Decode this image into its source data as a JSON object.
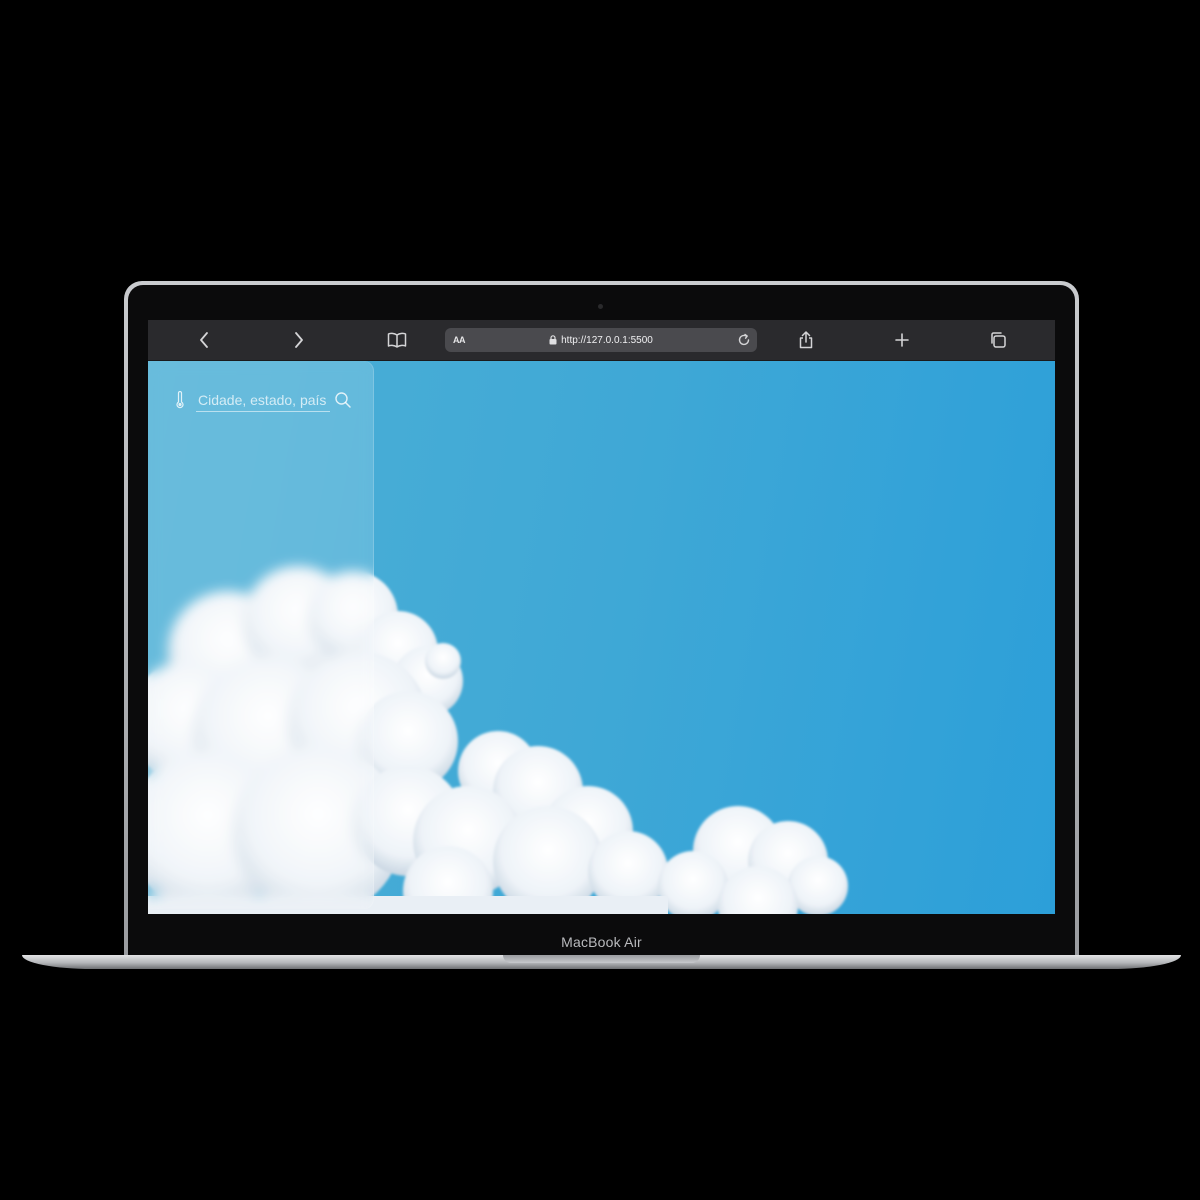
{
  "device": {
    "label": "MacBook Air"
  },
  "browser": {
    "reader_label": "AA",
    "url": "http://127.0.0.1:5500",
    "icons": [
      "back-icon",
      "forward-icon",
      "bookmarks-icon",
      "lock-icon",
      "reload-icon",
      "share-icon",
      "new-tab-icon",
      "tabs-icon"
    ]
  },
  "weather_app": {
    "search": {
      "placeholder": "Cidade, estado, país",
      "icon_left": "thermometer-icon",
      "button_icon": "search-icon"
    },
    "background": {
      "theme": "blue-sky-clouds",
      "sky_color": "#3fa8d6"
    }
  }
}
